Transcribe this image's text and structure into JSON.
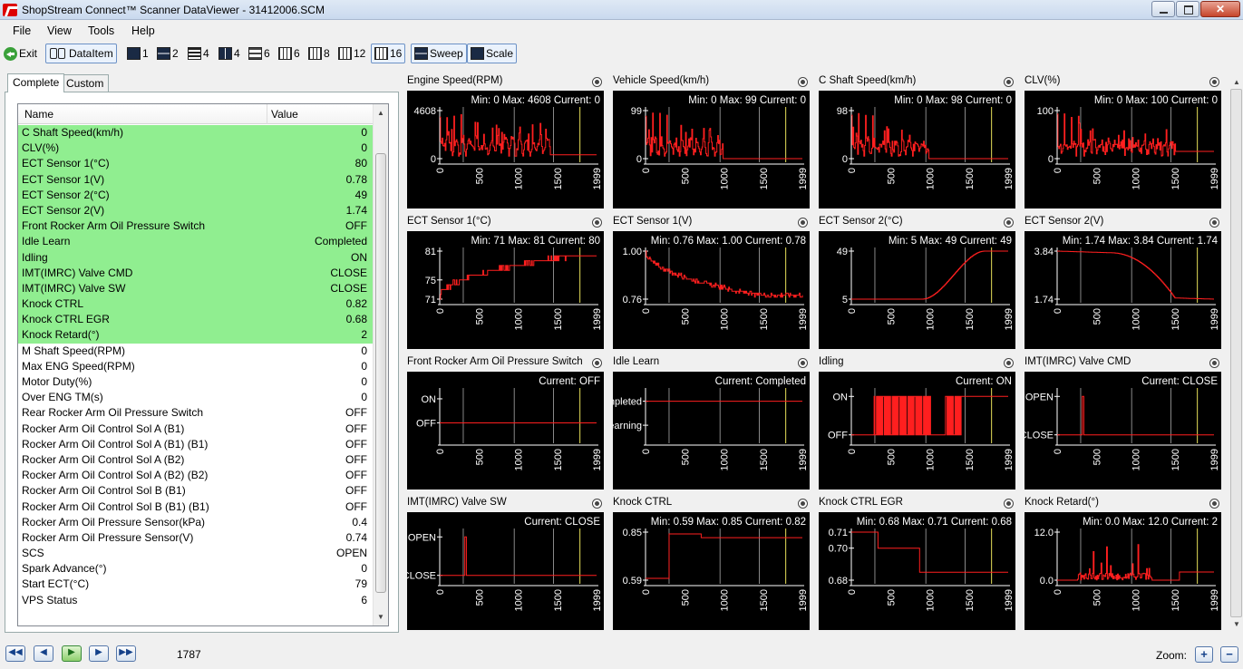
{
  "window": {
    "title": "ShopStream Connect™ Scanner DataViewer - 31412006.SCM"
  },
  "menu": [
    "File",
    "View",
    "Tools",
    "Help"
  ],
  "toolbar": {
    "exit": "Exit",
    "dataitem": "DataItem",
    "layouts": [
      "1",
      "2",
      "4",
      "4",
      "6",
      "6",
      "8",
      "12",
      "16"
    ],
    "sweep": "Sweep",
    "scale": "Scale"
  },
  "tabs": [
    "Complete",
    "Custom"
  ],
  "list": {
    "col_name": "Name",
    "col_value": "Value",
    "rows": [
      {
        "name": "C Shaft Speed(km/h)",
        "value": "0",
        "hl": true
      },
      {
        "name": "CLV(%)",
        "value": "0",
        "hl": true
      },
      {
        "name": "ECT Sensor 1(°C)",
        "value": "80",
        "hl": true
      },
      {
        "name": "ECT Sensor 1(V)",
        "value": "0.78",
        "hl": true
      },
      {
        "name": "ECT Sensor 2(°C)",
        "value": "49",
        "hl": true
      },
      {
        "name": "ECT Sensor 2(V)",
        "value": "1.74",
        "hl": true
      },
      {
        "name": "Front Rocker Arm Oil Pressure Switch",
        "value": "OFF",
        "hl": true
      },
      {
        "name": "Idle Learn",
        "value": "Completed",
        "hl": true
      },
      {
        "name": "Idling",
        "value": "ON",
        "hl": true
      },
      {
        "name": "IMT(IMRC) Valve CMD",
        "value": "CLOSE",
        "hl": true
      },
      {
        "name": "IMT(IMRC) Valve SW",
        "value": "CLOSE",
        "hl": true
      },
      {
        "name": "Knock CTRL",
        "value": "0.82",
        "hl": true
      },
      {
        "name": "Knock CTRL EGR",
        "value": "0.68",
        "hl": true
      },
      {
        "name": "Knock Retard(°)",
        "value": "2",
        "hl": true
      },
      {
        "name": "M Shaft Speed(RPM)",
        "value": "0",
        "hl": false
      },
      {
        "name": "Max ENG Speed(RPM)",
        "value": "0",
        "hl": false
      },
      {
        "name": "Motor Duty(%)",
        "value": "0",
        "hl": false
      },
      {
        "name": "Over ENG TM(s)",
        "value": "0",
        "hl": false
      },
      {
        "name": "Rear Rocker Arm Oil Pressure Switch",
        "value": "OFF",
        "hl": false
      },
      {
        "name": "Rocker Arm Oil Control Sol A (B1)",
        "value": "OFF",
        "hl": false
      },
      {
        "name": "Rocker Arm Oil Control Sol A (B1) (B1)",
        "value": "OFF",
        "hl": false
      },
      {
        "name": "Rocker Arm Oil Control Sol A (B2)",
        "value": "OFF",
        "hl": false
      },
      {
        "name": "Rocker Arm Oil Control Sol A (B2) (B2)",
        "value": "OFF",
        "hl": false
      },
      {
        "name": "Rocker Arm Oil Control Sol B (B1)",
        "value": "OFF",
        "hl": false
      },
      {
        "name": "Rocker Arm Oil Control Sol B (B1) (B1)",
        "value": "OFF",
        "hl": false
      },
      {
        "name": "Rocker Arm Oil Pressure Sensor(kPa)",
        "value": "0.4",
        "hl": false
      },
      {
        "name": "Rocker Arm Oil Pressure Sensor(V)",
        "value": "0.74",
        "hl": false
      },
      {
        "name": "SCS",
        "value": "OPEN",
        "hl": false
      },
      {
        "name": "Spark Advance(°)",
        "value": "0",
        "hl": false
      },
      {
        "name": "Start ECT(°C)",
        "value": "79",
        "hl": false
      },
      {
        "name": "VPS Status",
        "value": "6",
        "hl": false
      }
    ]
  },
  "x_ticks": [
    "0",
    "500",
    "1000",
    "1500",
    "1999"
  ],
  "x_range": [
    0,
    1999
  ],
  "cursor": 1787,
  "charts": [
    {
      "title": "Engine Speed(RPM)",
      "stats": "Min: 0    Max: 4608    Current: 0",
      "ymin": 0,
      "ymax": 4608,
      "yticks": [
        "4608",
        "0"
      ],
      "shape": "spiky",
      "params": [
        0.5,
        1400,
        0.08
      ]
    },
    {
      "title": "Vehicle Speed(km/h)",
      "stats": "Min: 0    Max: 99    Current: 0",
      "ymin": 0,
      "ymax": 99,
      "yticks": [
        "99",
        "0"
      ],
      "shape": "spiky",
      "params": [
        0.4,
        980,
        0.0
      ]
    },
    {
      "title": "C Shaft Speed(km/h)",
      "stats": "Min: 0    Max: 98    Current: 0",
      "ymin": 0,
      "ymax": 98,
      "yticks": [
        "98",
        "0"
      ],
      "shape": "spiky",
      "params": [
        0.4,
        980,
        0.0
      ]
    },
    {
      "title": "CLV(%)",
      "stats": "Min: 0    Max: 100    Current: 0",
      "ymin": 0,
      "ymax": 100,
      "yticks": [
        "100",
        "0"
      ],
      "shape": "spiky",
      "params": [
        0.35,
        1500,
        0.15
      ]
    },
    {
      "title": "ECT Sensor 1(°C)",
      "stats": "Min: 71    Max: 81    Current: 80",
      "ymin": 71,
      "ymax": 81,
      "yticks": [
        "81",
        "75",
        "71"
      ],
      "shape": "stair_up",
      "params": [
        71,
        80
      ]
    },
    {
      "title": "ECT Sensor 1(V)",
      "stats": "Min: 0.76    Max: 1.00    Current: 0.78",
      "ymin": 0.76,
      "ymax": 1.0,
      "yticks": [
        "1.00",
        "0.76"
      ],
      "shape": "stair_down",
      "params": [
        1.0,
        0.78
      ]
    },
    {
      "title": "ECT Sensor 2(°C)",
      "stats": "Min: 5    Max: 49    Current: 49",
      "ymin": 5,
      "ymax": 49,
      "yticks": [
        "49",
        "5"
      ],
      "shape": "rise",
      "params": [
        5,
        49
      ]
    },
    {
      "title": "ECT Sensor 2(V)",
      "stats": "Min: 1.74    Max: 3.84    Current: 1.74",
      "ymin": 1.74,
      "ymax": 3.84,
      "yticks": [
        "3.84",
        "1.74"
      ],
      "shape": "fall",
      "params": [
        3.84,
        1.74
      ]
    },
    {
      "title": "Front Rocker Arm Oil Pressure Switch",
      "stats": "Current: OFF",
      "ymin": 0,
      "ymax": 1,
      "ytickpos": [
        0.85,
        0.35
      ],
      "yticks": [
        "ON",
        "OFF"
      ],
      "shape": "flat",
      "params": [
        0.35
      ]
    },
    {
      "title": "Idle Learn",
      "stats": "Current: Completed",
      "ymin": 0,
      "ymax": 1,
      "ytickpos": [
        0.8,
        0.3
      ],
      "yticks": [
        "Completed",
        "Learning"
      ],
      "shape": "flat",
      "params": [
        0.8
      ]
    },
    {
      "title": "Idling",
      "stats": "Current: ON",
      "ymin": 0,
      "ymax": 1,
      "ytickpos": [
        0.9,
        0.1
      ],
      "yticks": [
        "ON",
        "OFF"
      ],
      "shape": "square",
      "params": [
        0.1,
        0.9
      ]
    },
    {
      "title": "IMT(IMRC) Valve CMD",
      "stats": "Current: CLOSE",
      "ymin": 0,
      "ymax": 1,
      "ytickpos": [
        0.9,
        0.1
      ],
      "yticks": [
        "OPEN",
        "CLOSE"
      ],
      "shape": "pulse",
      "params": [
        0.1,
        0.9
      ]
    },
    {
      "title": "IMT(IMRC) Valve SW",
      "stats": "Current: CLOSE",
      "ymin": 0,
      "ymax": 1,
      "ytickpos": [
        0.9,
        0.1
      ],
      "yticks": [
        "OPEN",
        "CLOSE"
      ],
      "shape": "pulse",
      "params": [
        0.1,
        0.9
      ]
    },
    {
      "title": "Knock CTRL",
      "stats": "Min: 0.59    Max: 0.85    Current: 0.82",
      "ymin": 0.59,
      "ymax": 0.85,
      "yticks": [
        "0.85",
        "0.59"
      ],
      "shape": "step_up",
      "params": [
        0.6,
        0.84,
        0.82
      ]
    },
    {
      "title": "Knock CTRL EGR",
      "stats": "Min: 0.68    Max: 0.71    Current: 0.68",
      "ymin": 0.68,
      "ymax": 0.71,
      "yticks": [
        "0.71",
        "0.70",
        "0.68"
      ],
      "yvals": [
        0.71,
        0.7,
        0.68
      ],
      "shape": "steps_down",
      "params": [
        0.71,
        0.7,
        0.685
      ]
    },
    {
      "title": "Knock Retard(°)",
      "stats": "Min: 0.0    Max: 12.0    Current: 2",
      "ymin": 0,
      "ymax": 12,
      "yticks": [
        "12.0",
        "0.0"
      ],
      "shape": "spiky_low",
      "params": [
        0,
        2
      ]
    }
  ],
  "status": {
    "frame": "1787",
    "zoom_label": "Zoom:"
  }
}
